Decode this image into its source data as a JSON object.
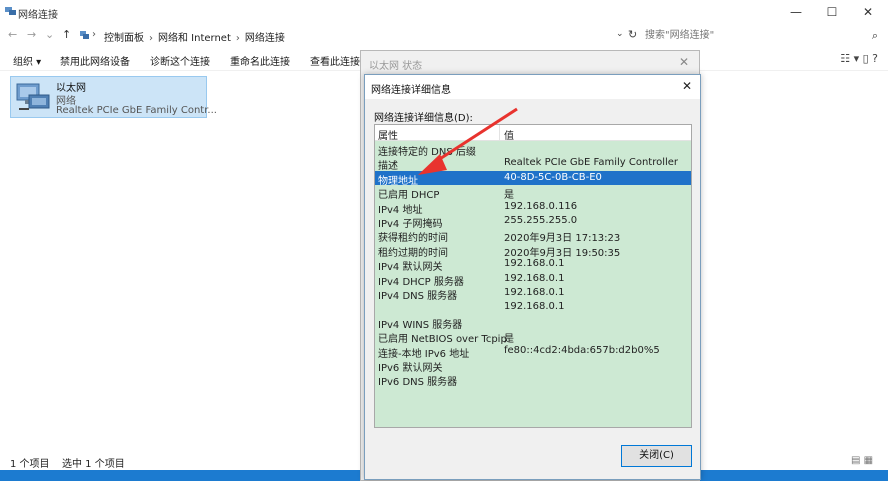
{
  "window": {
    "title": "网络连接"
  },
  "window_controls": {
    "minimize": "—",
    "maximize": "☐",
    "close": "✕"
  },
  "nav": {
    "back": "←",
    "forward": "→",
    "recent": "⌄",
    "up": "↑"
  },
  "address": {
    "crumbs": [
      "控制面板",
      "网络和 Internet",
      "网络连接"
    ],
    "dropdown": "⌄",
    "refresh": "↻"
  },
  "search": {
    "placeholder": "搜索\"网络连接\"",
    "icon": "search-icon"
  },
  "toolbar": {
    "items": [
      "组织 ▾",
      "禁用此网络设备",
      "诊断这个连接",
      "重命名此连接",
      "查看此连接的"
    ],
    "view_icons": "☷ ▾  ▯  ?"
  },
  "connection_item": {
    "name": "以太网",
    "type": "网络",
    "adapter": "Realtek PCIe GbE Family Contr..."
  },
  "status": {
    "count": "1 个项目",
    "selected": "选中 1 个项目"
  },
  "status_window": {
    "title": "以太网 状态",
    "close": "✕"
  },
  "dialog": {
    "title": "网络连接详细信息",
    "close": "✕",
    "label": "网络连接详细信息(D):",
    "header": {
      "property": "属性",
      "value": "值"
    },
    "rows": [
      {
        "property": "连接特定的 DNS 后缀",
        "value": ""
      },
      {
        "property": "描述",
        "value": "Realtek PCIe GbE Family Controller"
      },
      {
        "property": "物理地址",
        "value": "40-8D-5C-0B-CB-E0",
        "selected": true
      },
      {
        "property": "已启用 DHCP",
        "value": "是"
      },
      {
        "property": "IPv4 地址",
        "value": "192.168.0.116"
      },
      {
        "property": "IPv4 子网掩码",
        "value": "255.255.255.0"
      },
      {
        "property": "获得租约的时间",
        "value": "2020年9月3日 17:13:23"
      },
      {
        "property": "租约过期的时间",
        "value": "2020年9月3日 19:50:35"
      },
      {
        "property": "IPv4 默认网关",
        "value": "192.168.0.1"
      },
      {
        "property": "IPv4 DHCP 服务器",
        "value": "192.168.0.1"
      },
      {
        "property": "IPv4 DNS 服务器",
        "value": "192.168.0.1"
      },
      {
        "property": "",
        "value": "192.168.0.1"
      },
      {
        "property": "IPv4 WINS 服务器",
        "value": ""
      },
      {
        "property": "已启用 NetBIOS over Tcpip",
        "value": "是"
      },
      {
        "property": "连接-本地 IPv6 地址",
        "value": "fe80::4cd2:4bda:657b:d2b0%5"
      },
      {
        "property": "IPv6 默认网关",
        "value": ""
      },
      {
        "property": "IPv6 DNS 服务器",
        "value": ""
      }
    ],
    "close_button": "关闭(C)"
  },
  "colors": {
    "selection": "#1f72c9",
    "list_bg": "#cde9d3",
    "arrow": "#e8332e",
    "taskbar": "#1c7bd0"
  }
}
